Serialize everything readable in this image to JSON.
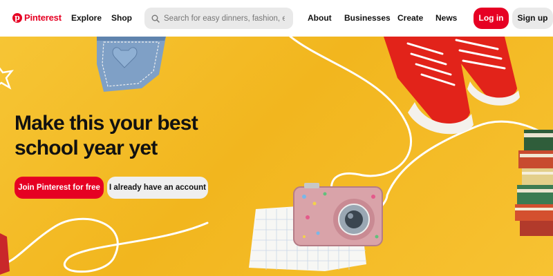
{
  "header": {
    "logo_text": "Pinterest",
    "nav": {
      "explore": "Explore",
      "shop": "Shop",
      "about": "About",
      "businesses": "Businesses",
      "create": "Create",
      "news": "News"
    },
    "search": {
      "placeholder": "Search for easy dinners, fashion, et",
      "icon": "search-icon"
    },
    "login_label": "Log in",
    "signup_label": "Sign up"
  },
  "hero": {
    "headline_line1": "Make this your best",
    "headline_line2": "school year yet",
    "join_label": "Join Pinterest for free",
    "login_label": "I already have an account",
    "background_color": "#f4bd2a"
  },
  "colors": {
    "brand": "#e60023",
    "text": "#111111",
    "chip": "#e9e9e9"
  }
}
